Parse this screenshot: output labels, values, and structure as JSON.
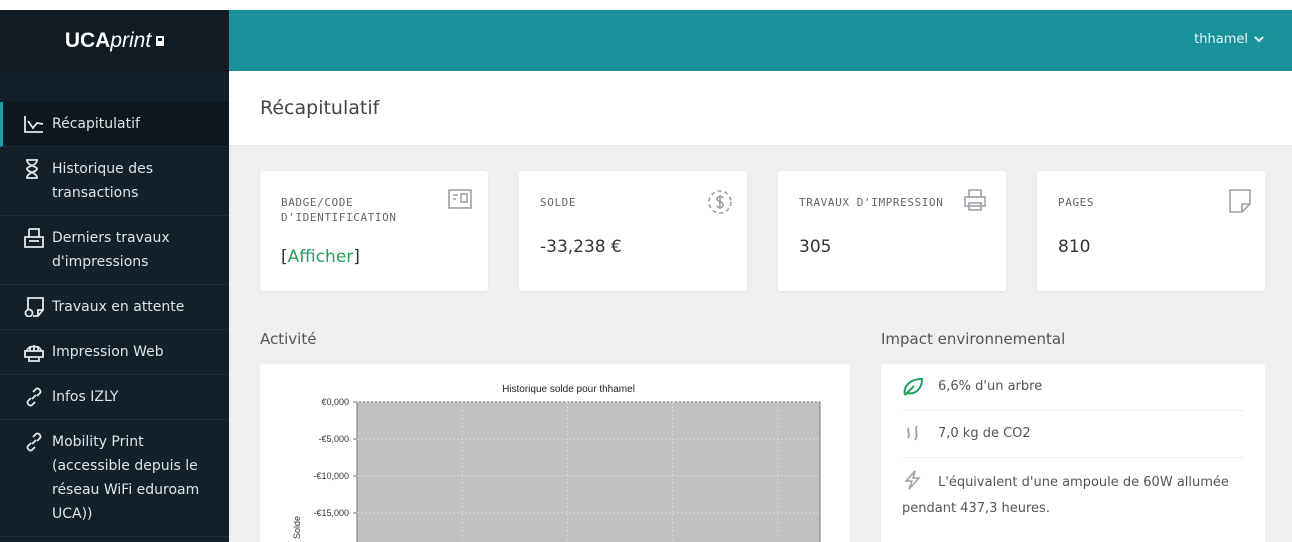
{
  "brand": {
    "bold": "UCA",
    "italic": "print"
  },
  "user": {
    "name": "thhamel"
  },
  "page": {
    "title": "Récapitulatif"
  },
  "nav": [
    {
      "label": "Récapitulatif",
      "icon": "chart-line-icon"
    },
    {
      "label": "Historique des transactions",
      "icon": "hourglass-icon"
    },
    {
      "label": "Derniers travaux d'impressions",
      "icon": "printer-output-icon"
    },
    {
      "label": "Travaux en attente",
      "icon": "pending-jobs-icon"
    },
    {
      "label": "Impression Web",
      "icon": "web-print-icon"
    },
    {
      "label": "Infos IZLY",
      "icon": "link-icon"
    },
    {
      "label": "Mobility Print (accessible depuis le réseau WiFi eduroam UCA))",
      "icon": "link-icon"
    }
  ],
  "cards": {
    "badge": {
      "label": "BADGE/CODE D'IDENTIFICATION",
      "bracket_open": "[",
      "link": "Afficher",
      "bracket_close": "]",
      "icon": "id-card-icon"
    },
    "balance": {
      "label": "SOLDE",
      "value": "-33,238 €",
      "icon": "dollar-circle-icon"
    },
    "jobs": {
      "label": "TRAVAUX D'IMPRESSION",
      "value": "305",
      "icon": "printer-icon"
    },
    "pages": {
      "label": "PAGES",
      "value": "810",
      "icon": "page-icon"
    }
  },
  "sections": {
    "activity": "Activité",
    "environment": "Impact environnemental"
  },
  "chart_data": {
    "type": "area",
    "title": "Historique solde pour thhamel",
    "ylabel": "Solde",
    "y_ticks": [
      "€0,000",
      "-€5,000",
      "-€10,000",
      "-€15,000"
    ],
    "ylim": [
      -15000,
      0
    ],
    "grid": true
  },
  "environment": [
    {
      "text": "6,6% d'un arbre",
      "icon": "leaf-icon"
    },
    {
      "text": "7,0 kg de CO2",
      "icon": "smoke-icon"
    },
    {
      "text": "L'équivalent d'une ampoule de 60W allumée pendant 437,3 heures.",
      "icon": "bolt-icon"
    }
  ],
  "colors": {
    "topbar": "#1a9299",
    "sidebar": "#132029",
    "link": "#21a35b",
    "leaf": "#21a35b"
  }
}
